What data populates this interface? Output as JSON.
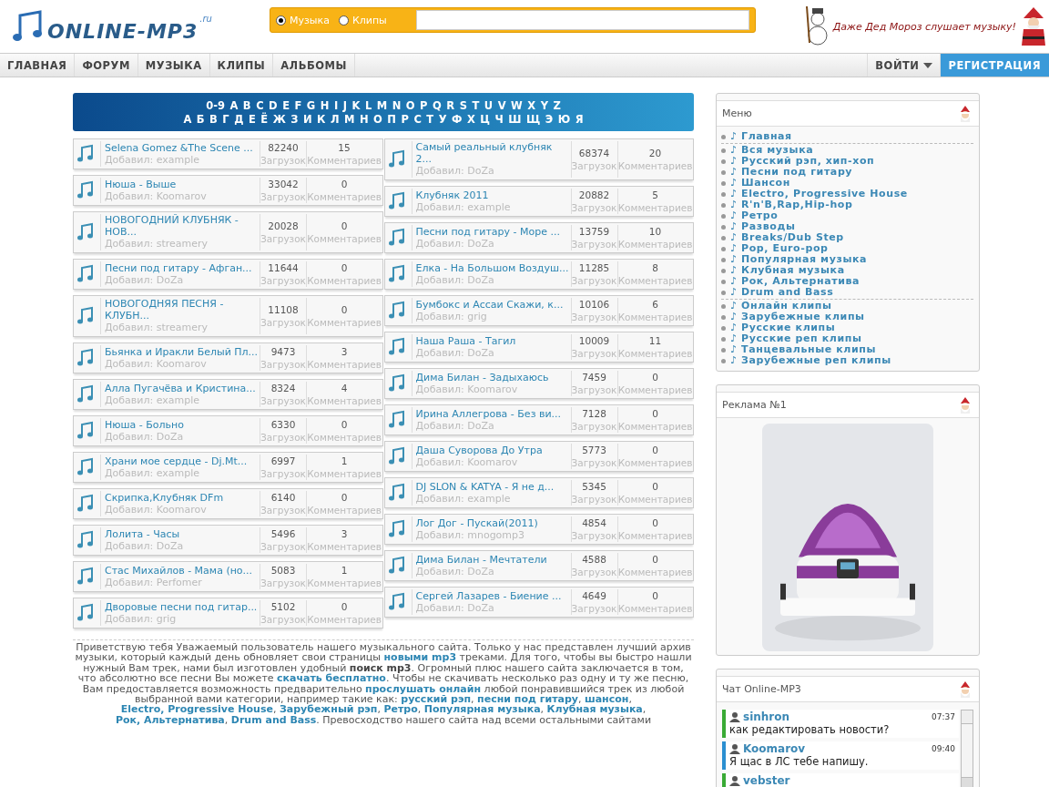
{
  "logo": {
    "name": "ONLINE-MP3",
    "suffix": ".ru"
  },
  "search": {
    "options": [
      {
        "label": "Музыка",
        "selected": true
      },
      {
        "label": "Клипы",
        "selected": false
      }
    ]
  },
  "promo": {
    "text": "Даже Дед Мороз слушает музыку!"
  },
  "nav": {
    "items": [
      "ГЛАВНАЯ",
      "ФОРУМ",
      "МУЗЫКА",
      "КЛИПЫ",
      "АЛЬБОМЫ"
    ],
    "right": [
      {
        "label": "ВОЙТИ",
        "kind": "dropdown"
      },
      {
        "label": "РЕГИСТРАЦИЯ",
        "kind": "primary"
      }
    ]
  },
  "alphabet": [
    [
      "0-9",
      "A",
      "B",
      "C",
      "D",
      "E",
      "F",
      "G",
      "H",
      "I",
      "J",
      "K",
      "L",
      "M",
      "N",
      "O",
      "P",
      "Q",
      "R",
      "S",
      "T",
      "U",
      "V",
      "W",
      "X",
      "Y",
      "Z"
    ],
    [
      "А",
      "Б",
      "В",
      "Г",
      "Д",
      "Е",
      "Ё",
      "Ж",
      "З",
      "И",
      "К",
      "Л",
      "М",
      "Н",
      "О",
      "П",
      "Р",
      "С",
      "Т",
      "У",
      "Ф",
      "Х",
      "Ц",
      "Ч",
      "Ш",
      "Щ",
      "Э",
      "Ю",
      "Я"
    ]
  ],
  "tracks": {
    "left": [
      {
        "title": "Selena Gomez &The Scene ...",
        "added_by": "Добавил: example",
        "downloads": "82240",
        "downloads_label": "Загрузок",
        "comments": "15",
        "comments_label": "Комментариев"
      },
      {
        "title": "Нюша - Выше",
        "added_by": "Добавил: Koomarov",
        "downloads": "33042",
        "downloads_label": "Загрузок",
        "comments": "0",
        "comments_label": "Комментариев"
      },
      {
        "title": "НОВОГОДНИЙ КЛУБНЯК - НОВ...",
        "added_by": "Добавил: streamery",
        "downloads": "20028",
        "downloads_label": "Загрузок",
        "comments": "0",
        "comments_label": "Комментариев"
      },
      {
        "title": "Песни под гитару - Афган...",
        "added_by": "Добавил: DoZa",
        "downloads": "11644",
        "downloads_label": "Загрузок",
        "comments": "0",
        "comments_label": "Комментариев"
      },
      {
        "title": "НОВОГОДНЯЯ ПЕСНЯ - КЛУБН...",
        "added_by": "Добавил: streamery",
        "downloads": "11108",
        "downloads_label": "Загрузок",
        "comments": "0",
        "comments_label": "Комментариев"
      },
      {
        "title": "Бьянка и Иракли Белый Пл...",
        "added_by": "Добавил: Koomarov",
        "downloads": "9473",
        "downloads_label": "Загрузок",
        "comments": "3",
        "comments_label": "Комментариев"
      },
      {
        "title": "Алла Пугачёва и Кристина...",
        "added_by": "Добавил: example",
        "downloads": "8324",
        "downloads_label": "Загрузок",
        "comments": "4",
        "comments_label": "Комментариев"
      },
      {
        "title": "Нюша - Больно",
        "added_by": "Добавил: DoZa",
        "downloads": "6330",
        "downloads_label": "Загрузок",
        "comments": "0",
        "comments_label": "Комментариев"
      },
      {
        "title": "Храни мое сердце - Dj.Mt...",
        "added_by": "Добавил: example",
        "downloads": "6997",
        "downloads_label": "Загрузок",
        "comments": "1",
        "comments_label": "Комментариев"
      },
      {
        "title": "Скрипка,Клубняк DFm",
        "added_by": "Добавил: Koomarov",
        "downloads": "6140",
        "downloads_label": "Загрузок",
        "comments": "0",
        "comments_label": "Комментариев"
      },
      {
        "title": "Лолита - Часы",
        "added_by": "Добавил: DoZa",
        "downloads": "5496",
        "downloads_label": "Загрузок",
        "comments": "3",
        "comments_label": "Комментариев"
      },
      {
        "title": "Стас Михайлов - Мама (но...",
        "added_by": "Добавил: Perfomer",
        "downloads": "5083",
        "downloads_label": "Загрузок",
        "comments": "1",
        "comments_label": "Комментариев"
      },
      {
        "title": "Дворовые песни под гитар...",
        "added_by": "Добавил: grig",
        "downloads": "5102",
        "downloads_label": "Загрузок",
        "comments": "0",
        "comments_label": "Комментариев"
      }
    ],
    "right": [
      {
        "title": "Самый реальный клубняк 2...",
        "added_by": "Добавил: DoZa",
        "downloads": "68374",
        "downloads_label": "Загрузок",
        "comments": "20",
        "comments_label": "Комментариев"
      },
      {
        "title": "Клубняк 2011",
        "added_by": "Добавил: example",
        "downloads": "20882",
        "downloads_label": "Загрузок",
        "comments": "5",
        "comments_label": "Комментариев"
      },
      {
        "title": "Песни под гитару - Море ...",
        "added_by": "Добавил: DoZa",
        "downloads": "13759",
        "downloads_label": "Загрузок",
        "comments": "10",
        "comments_label": "Комментариев"
      },
      {
        "title": "Елка - На Большом Воздуш...",
        "added_by": "Добавил: DoZa",
        "downloads": "11285",
        "downloads_label": "Загрузок",
        "comments": "8",
        "comments_label": "Комментариев"
      },
      {
        "title": "Бумбокс и Ассаи Скажи, к...",
        "added_by": "Добавил: grig",
        "downloads": "10106",
        "downloads_label": "Загрузок",
        "comments": "6",
        "comments_label": "Комментариев"
      },
      {
        "title": "Наша Раша - Тагил",
        "added_by": "Добавил: DoZa",
        "downloads": "10009",
        "downloads_label": "Загрузок",
        "comments": "11",
        "comments_label": "Комментариев"
      },
      {
        "title": "Дима Билан - Задыхаюсь",
        "added_by": "Добавил: Koomarov",
        "downloads": "7459",
        "downloads_label": "Загрузок",
        "comments": "0",
        "comments_label": "Комментариев"
      },
      {
        "title": "Ирина Аллегрова - Без ви...",
        "added_by": "Добавил: DoZa",
        "downloads": "7128",
        "downloads_label": "Загрузок",
        "comments": "0",
        "comments_label": "Комментариев"
      },
      {
        "title": "Даша Суворова До Утра",
        "added_by": "Добавил: Koomarov",
        "downloads": "5773",
        "downloads_label": "Загрузок",
        "comments": "0",
        "comments_label": "Комментариев"
      },
      {
        "title": "DJ SLON & KATYA - Я не д...",
        "added_by": "Добавил: example",
        "downloads": "5345",
        "downloads_label": "Загрузок",
        "comments": "0",
        "comments_label": "Комментариев"
      },
      {
        "title": "Лог Дог - Пускай(2011)",
        "added_by": "Добавил: mnogomp3",
        "downloads": "4854",
        "downloads_label": "Загрузок",
        "comments": "0",
        "comments_label": "Комментариев"
      },
      {
        "title": "Дима Билан - Мечтатели",
        "added_by": "Добавил: DoZa",
        "downloads": "4588",
        "downloads_label": "Загрузок",
        "comments": "0",
        "comments_label": "Комментариев"
      },
      {
        "title": "Сергей Лазарев - Биение ...",
        "added_by": "Добавил: DoZa",
        "downloads": "4649",
        "downloads_label": "Загрузок",
        "comments": "0",
        "comments_label": "Комментариев"
      }
    ]
  },
  "intro": [
    {
      "kind": "plain",
      "text": "Приветствую тебя Уважаемый пользователь нашего музыкального сайта. Только у нас представлен лучший архив музыки, который каждый день обновляет свои страницы "
    },
    {
      "kind": "link",
      "text": "новыми mp3"
    },
    {
      "kind": "plain",
      "text": " треками. Для того, чтобы вы быстро нашли нужный Вам трек, нами был изготовлен удобный "
    },
    {
      "kind": "bold",
      "text": "поиск mp3"
    },
    {
      "kind": "plain",
      "text": ". Огромный плюс нашего сайта заключается в том, что абсолютно все песни Вы можете "
    },
    {
      "kind": "link",
      "text": "скачать бесплатно"
    },
    {
      "kind": "plain",
      "text": ". Чтобы не скачивать несколько раз одну и ту же песню, Вам предоставляется возможность предварительно "
    },
    {
      "kind": "link",
      "text": "прослушать онлайн"
    },
    {
      "kind": "plain",
      "text": " любой понравившийся трек из любой выбранной вами категории, например такие как: "
    },
    {
      "kind": "link",
      "text": "русский рэп"
    },
    {
      "kind": "plain",
      "text": ", "
    },
    {
      "kind": "link",
      "text": "песни под гитару"
    },
    {
      "kind": "plain",
      "text": ", "
    },
    {
      "kind": "link",
      "text": "шансон"
    },
    {
      "kind": "plain",
      "text": ", "
    },
    {
      "kind": "link",
      "text": "Electro, Progressive House"
    },
    {
      "kind": "plain",
      "text": ", "
    },
    {
      "kind": "link",
      "text": "Зарубежный рэп"
    },
    {
      "kind": "plain",
      "text": ", "
    },
    {
      "kind": "link",
      "text": "Ретро"
    },
    {
      "kind": "plain",
      "text": ", "
    },
    {
      "kind": "link",
      "text": "Популярная музыка"
    },
    {
      "kind": "plain",
      "text": ", "
    },
    {
      "kind": "link",
      "text": "Клубная музыка"
    },
    {
      "kind": "plain",
      "text": ", "
    },
    {
      "kind": "link",
      "text": "Рок, Альтернатива"
    },
    {
      "kind": "plain",
      "text": ", "
    },
    {
      "kind": "link",
      "text": "Drum and Bass"
    },
    {
      "kind": "plain",
      "text": ". Превосходство нашего сайта над всеми остальными сайтами"
    }
  ],
  "menu": {
    "title": "Меню",
    "groups": [
      [
        "♪ Главная"
      ],
      [
        "♪ Вся музыка",
        "♪ Русский рэп, хип-хоп",
        "♪ Песни под гитару",
        "♪ Шансон",
        "♪ Electro, Progressive House",
        "♪ R'n'B,Rap,Hip-hop",
        "♪ Ретро",
        "♪ Разводы",
        "♪ Breaks/Dub Step",
        "♪ Pop, Euro-pop",
        "♪ Популярная музыка",
        "♪ Клубная музыка",
        "♪ Рок, Альтернатива",
        "♪ Drum and Bass"
      ],
      [
        "♪ Онлайн клипы",
        "♪ Зарубежные клипы",
        "♪ Русские клипы",
        "♪ Русские реп клипы",
        "♪ Танцевальные клипы",
        "♪ Зарубежные реп клипы"
      ]
    ]
  },
  "ad": {
    "title": "Реклама №1",
    "kind": "picture"
  },
  "chat": {
    "title": "Чат Online-MP3",
    "messages": [
      {
        "user": "sinhron",
        "time": "07:37",
        "text": "как редактировать новости?",
        "color": "#3aaa35"
      },
      {
        "user": "Koomarov",
        "time": "09:40",
        "text": "Я щас в ЛС тебе напишу.",
        "color": "#2b8fd0"
      },
      {
        "user": "vebster",
        "color": "#3aaa35"
      }
    ]
  }
}
